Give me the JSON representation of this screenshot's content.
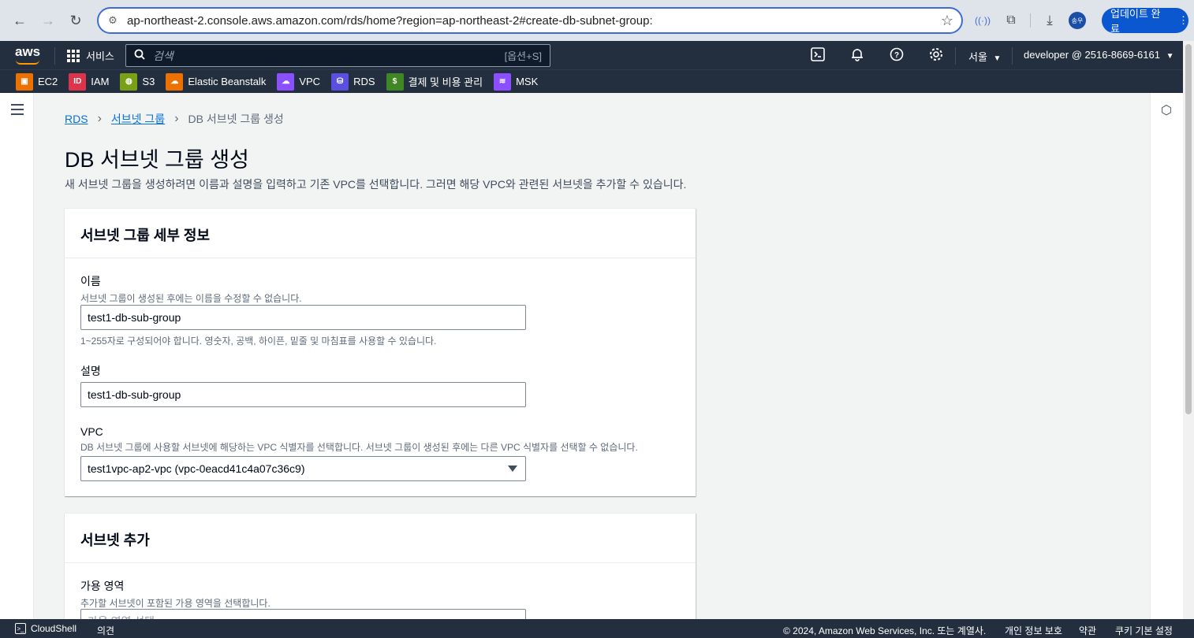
{
  "browser": {
    "url": "ap-northeast-2.console.aws.amazon.com/rds/home?region=ap-northeast-2#create-db-subnet-group:",
    "profile_label": "송우",
    "update_label": "업데이트 완료"
  },
  "aws_header": {
    "logo": "aws",
    "services_label": "서비스",
    "search_placeholder": "검색",
    "search_shortcut": "[옵션+S]",
    "region": "서울",
    "account": "developer @ 2516-8669-6161"
  },
  "favorites": [
    {
      "label": "EC2",
      "color": "#ed7100",
      "icon": "ec2-icon"
    },
    {
      "label": "IAM",
      "color": "#dd344c",
      "icon": "iam-icon"
    },
    {
      "label": "S3",
      "color": "#7aa116",
      "icon": "s3-icon"
    },
    {
      "label": "Elastic Beanstalk",
      "color": "#ed7100",
      "icon": "beanstalk-icon"
    },
    {
      "label": "VPC",
      "color": "#8c4fff",
      "icon": "vpc-icon"
    },
    {
      "label": "RDS",
      "color": "#5a4fe0",
      "icon": "rds-icon"
    },
    {
      "label": "결제 및 비용 관리",
      "color": "#3f8624",
      "icon": "billing-icon"
    },
    {
      "label": "MSK",
      "color": "#8c4fff",
      "icon": "msk-icon"
    }
  ],
  "breadcrumb": {
    "root": "RDS",
    "parent": "서브넷 그룹",
    "current": "DB 서브넷 그룹 생성"
  },
  "page": {
    "title": "DB 서브넷 그룹 생성",
    "description": "새 서브넷 그룹을 생성하려면 이름과 설명을 입력하고 기존 VPC를 선택합니다. 그러면 해당 VPC와 관련된 서브넷을 추가할 수 있습니다."
  },
  "details_panel": {
    "title": "서브넷 그룹 세부 정보",
    "name": {
      "label": "이름",
      "description": "서브넷 그룹이 생성된 후에는 이름을 수정할 수 없습니다.",
      "value": "test1-db-sub-group",
      "constraint": "1~255자로 구성되어야 합니다. 영숫자, 공백, 하이픈, 밑줄 및 마침표를 사용할 수 있습니다."
    },
    "desc": {
      "label": "설명",
      "value": "test1-db-sub-group"
    },
    "vpc": {
      "label": "VPC",
      "description": "DB 서브넷 그룹에 사용할 서브넷에 해당하는 VPC 식별자를 선택합니다. 서브넷 그룹이 생성된 후에는 다른 VPC 식별자를 선택할 수 없습니다.",
      "value": "test1vpc-ap2-vpc (vpc-0eacd41c4a07c36c9)"
    }
  },
  "subnet_panel": {
    "title": "서브넷 추가",
    "az_label": "가용 영역",
    "az_description": "추가할 서브넷이 포함된 가용 영역을 선택합니다.",
    "az_placeholder": "가용 영역 선택"
  },
  "footer": {
    "cloudshell": "CloudShell",
    "feedback": "의견",
    "copyright": "© 2024, Amazon Web Services, Inc. 또는 계열사.",
    "privacy": "개인 정보 보호",
    "terms": "약관",
    "cookies": "쿠키 기본 설정"
  }
}
